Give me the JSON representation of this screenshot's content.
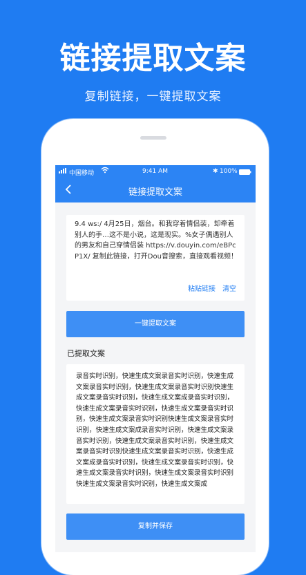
{
  "hero": {
    "title": "链接提取文案",
    "subtitle": "复制链接，一键提取文案"
  },
  "status_bar": {
    "carrier": "中国移动",
    "time": "9:41 AM",
    "battery": "100%"
  },
  "nav": {
    "title": "链接提取文案"
  },
  "input": {
    "text": "9.4 ws:/ 4月25日，烟台。和我穿着情侣装，却牵着别人的手…这不是小说，这是现实。%女子偶遇别人的男友和自己穿情侣装 https://v.douyin.com/eBPcP1X/ 复制此链接，打开Dou音搜索，直接观看视频！",
    "paste_label": "粘贴链接",
    "clear_label": "清空"
  },
  "extract_button": "一键提取文案",
  "result": {
    "section_title": "已提取文案",
    "text": "录音实时识别，快速生成文案录音实时识别，快速生成文案录音实时识别，快速生成文案录音实时识别快速生成文案录音实时识别，快速生成文案成录音实时识别，快速生成文案录音实时识别，快速生成文案录音实时识别，快速生成文案录音实时识别快速生成文案录音实时识别，快速生成文案成录音实时识别，快速生成文案录音实时识别，快速生成文案录音实时识别，快速生成文案录音实时识别快速生成文案录音实时识别，快速生成文案成录音实时识别，快速生成文案录音实时识别，快速生成文案录音实时识别，快速生成文案录音实时识别快速生成文案录音实时识别，快速生成文案成"
  },
  "save_button": "复制并保存",
  "colors": {
    "background": "#1f7cf2",
    "primary": "#2c84f4",
    "button": "#3e8ff5"
  }
}
